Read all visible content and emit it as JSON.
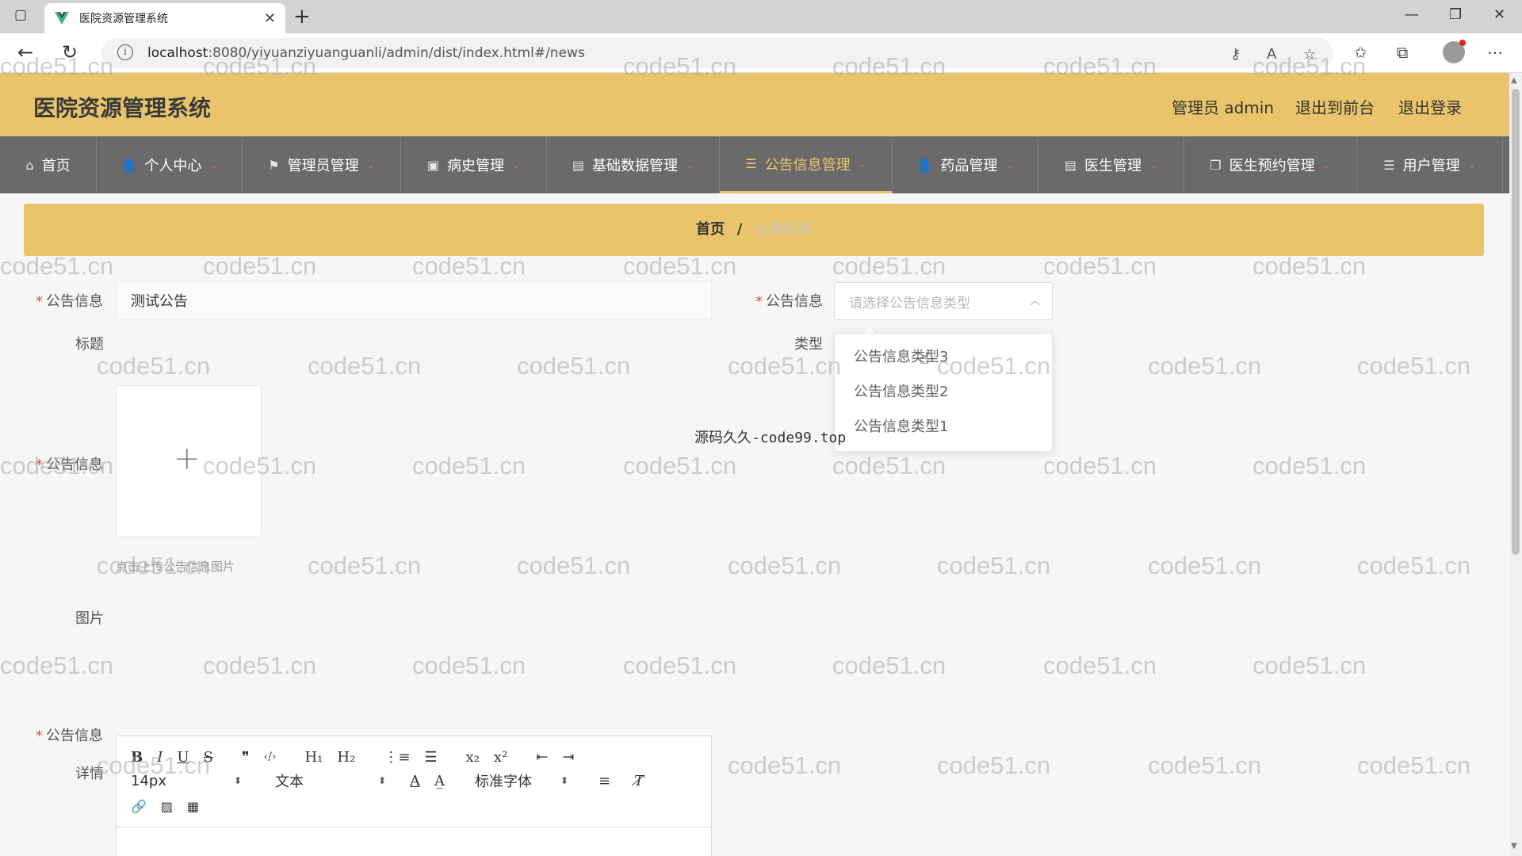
{
  "browser": {
    "tab_title": "医院资源管理系统",
    "tab_close": "✕",
    "new_tab": "+",
    "url_host": "localhost",
    "url_path": ":8080/yiyuanziyuanguanli/admin/dist/index.html#/news",
    "win_min": "—",
    "win_restore": "❐",
    "win_close": "✕"
  },
  "header": {
    "title": "医院资源管理系统",
    "user": "管理员 admin",
    "to_front": "退出到前台",
    "logout": "退出登录"
  },
  "nav": {
    "items": [
      {
        "label": "首页",
        "icon": "⌂",
        "caret": ""
      },
      {
        "label": "个人中心",
        "icon": "👤",
        "caret": "⌄"
      },
      {
        "label": "管理员管理",
        "icon": "⚑",
        "caret": "⌄"
      },
      {
        "label": "病史管理",
        "icon": "▣",
        "caret": "⌄"
      },
      {
        "label": "基础数据管理",
        "icon": "▤",
        "caret": "⌄"
      },
      {
        "label": "公告信息管理",
        "icon": "☰",
        "caret": "⌄"
      },
      {
        "label": "药品管理",
        "icon": "👤",
        "caret": "⌄"
      },
      {
        "label": "医生管理",
        "icon": "▤",
        "caret": "⌄"
      },
      {
        "label": "医生预约管理",
        "icon": "❐",
        "caret": "⌄"
      },
      {
        "label": "用户管理",
        "icon": "☰",
        "caret": "⌄"
      }
    ],
    "active_index": 5
  },
  "breadcrumb": {
    "home": "首页",
    "sep": "/",
    "current": "公告信息"
  },
  "form": {
    "title_label_a": "公告信息",
    "title_label_b": "标题",
    "title_value": "测试公告",
    "type_label_a": "公告信息",
    "type_label_b": "类型",
    "type_placeholder": "请选择公告信息类型",
    "type_options": [
      "公告信息类型3",
      "公告信息类型2",
      "公告信息类型1"
    ],
    "image_label_a": "公告信息",
    "image_label_b": "图片",
    "upload_plus": "+",
    "upload_hint": "点击上传公告信息图片",
    "detail_label_a": "公告信息",
    "detail_label_b": "详情",
    "required_mark": "*"
  },
  "editor": {
    "row1": [
      "B",
      "I",
      "U",
      "S",
      "❞",
      "‹/›",
      "H₁",
      "H₂",
      "⋮≡",
      "☰",
      "x₂",
      "x²",
      "⇤",
      "⇥"
    ],
    "font_size": "14px",
    "text_style": "文本",
    "font_family": "标准字体",
    "row2_icons": [
      "A",
      "A̲",
      "≡",
      "T̸"
    ],
    "row3": [
      "🔗",
      "▨",
      "▦"
    ],
    "select_arrow": "⬍"
  },
  "overlay_text": "源码久久-code99.top",
  "watermark": "code51.cn"
}
